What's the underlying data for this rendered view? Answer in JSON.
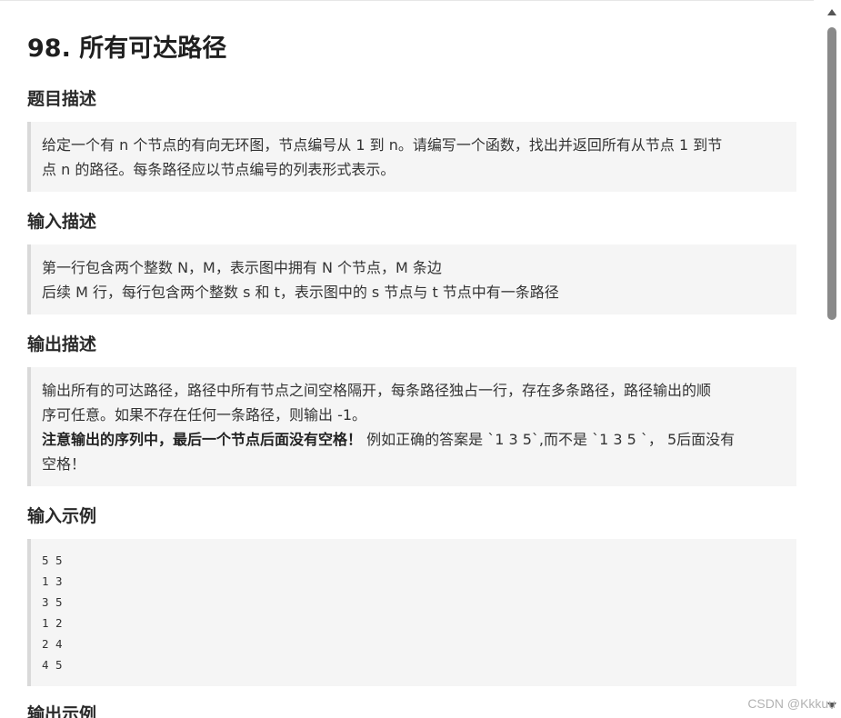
{
  "page": {
    "title": "98. 所有可达路径"
  },
  "sections": {
    "description": {
      "heading": "题目描述",
      "lines": [
        "给定一个有 n 个节点的有向无环图，节点编号从 1 到 n。请编写一个函数，找出并返回所有从节点 1 到节",
        "点 n 的路径。每条路径应以节点编号的列表形式表示。"
      ]
    },
    "input": {
      "heading": "输入描述",
      "lines": [
        "第一行包含两个整数 N，M，表示图中拥有 N 个节点，M 条边",
        "后续 M 行，每行包含两个整数 s 和 t，表示图中的 s 节点与 t 节点中有一条路径"
      ]
    },
    "output": {
      "heading": "输出描述",
      "lines": [
        "输出所有的可达路径，路径中所有节点之间空格隔开，每条路径独占一行，存在多条路径，路径输出的顺",
        "序可任意。如果不存在任何一条路径，则输出 -1。"
      ],
      "bold_note": "注意输出的序列中，最后一个节点后面没有空格！",
      "note_rest": " 例如正确的答案是 `1 3 5`,而不是 `1 3 5 `， 5后面没有",
      "note_last": "空格！"
    },
    "input_example": {
      "heading": "输入示例",
      "code_lines": [
        "5 5",
        "1 3",
        "3 5",
        "1 2",
        "2 4",
        "4 5"
      ]
    },
    "output_example": {
      "heading": "输出示例"
    }
  },
  "watermark": "CSDN @Kkkuu",
  "colors": {
    "quote_bg": "#f5f5f5",
    "quote_border": "#d9d9d9",
    "scroll_thumb": "#8a8a8a"
  }
}
